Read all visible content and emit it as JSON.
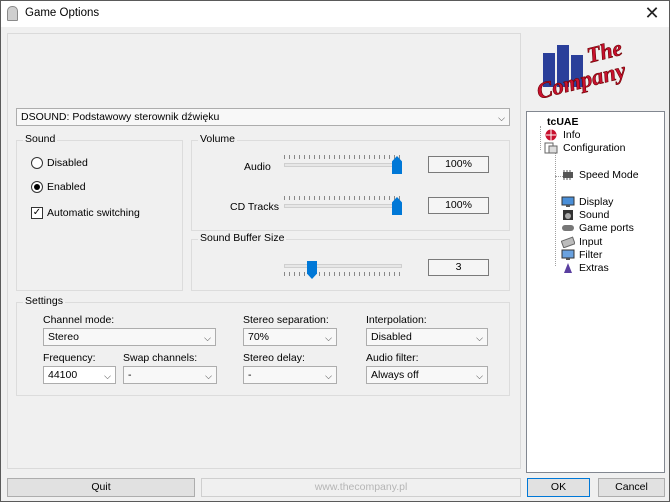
{
  "window": {
    "title": "Game Options",
    "close_glyph": "✕"
  },
  "driver": {
    "selected": "DSOUND: Podstawowy sterownik dźwięku"
  },
  "sound": {
    "label": "Sound",
    "disabled": "Disabled",
    "enabled": "Enabled",
    "auto_switch": "Automatic switching",
    "selected": "Enabled",
    "auto_switch_checked": true
  },
  "volume": {
    "label": "Volume",
    "audio_label": "Audio",
    "audio_value": "100%",
    "audio_level": 1.0,
    "cd_label": "CD Tracks",
    "cd_value": "100%",
    "cd_level": 1.0
  },
  "buffer": {
    "label": "Sound Buffer Size",
    "value": "3",
    "level": 0.25
  },
  "settings": {
    "label": "Settings",
    "channel_mode_label": "Channel mode:",
    "channel_mode_value": "Stereo",
    "stereo_sep_label": "Stereo separation:",
    "stereo_sep_value": "70%",
    "interp_label": "Interpolation:",
    "interp_value": "Disabled",
    "freq_label": "Frequency:",
    "freq_value": "44100",
    "swap_label": "Swap channels:",
    "swap_value": "-",
    "delay_label": "Stereo delay:",
    "delay_value": "-",
    "filter_label": "Audio filter:",
    "filter_value": "Always off"
  },
  "footer": {
    "quit": "Quit",
    "url": "www.thecompany.pl",
    "ok": "OK",
    "cancel": "Cancel"
  },
  "logo": {
    "line1": "The",
    "line2": "Company"
  },
  "tree": {
    "root": "tcUAE",
    "info": "Info",
    "configuration": "Configuration",
    "speed_mode": "Speed Mode",
    "display": "Display",
    "sound": "Sound",
    "game_ports": "Game ports",
    "input": "Input",
    "filter": "Filter",
    "extras": "Extras"
  },
  "colors": {
    "accent": "#0078d7",
    "logo_red": "#c8102e",
    "logo_blue": "#2a3f9a"
  }
}
